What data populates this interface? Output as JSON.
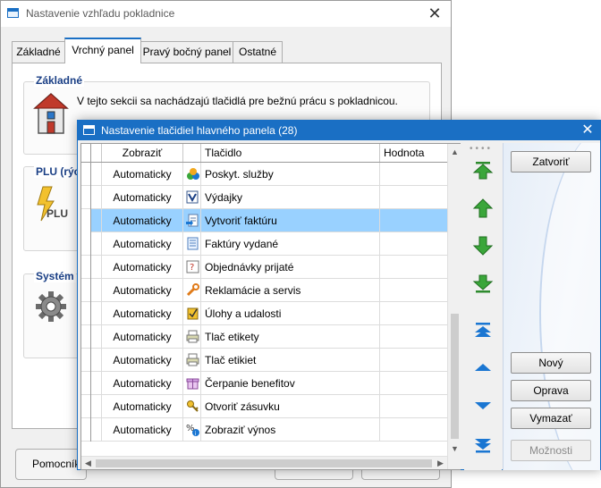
{
  "back_window": {
    "title": "Nastavenie vzhľadu pokladnice",
    "close_glyph": "✕",
    "tabs": [
      {
        "label": "Základné",
        "active": false
      },
      {
        "label": "Vrchný panel",
        "active": true
      },
      {
        "label": "Pravý bočný panel",
        "active": false
      },
      {
        "label": "Ostatné",
        "active": false
      }
    ],
    "groups": {
      "zakladne": {
        "title": "Základné",
        "text": "V tejto sekcii sa nachádzajú tlačidlá pre bežnú prácu s pokladnicou.",
        "icon": "house-icon"
      },
      "plu": {
        "title": "PLU (rých",
        "icon": "plu-lightning-icon"
      },
      "system": {
        "title": "Systém",
        "icon": "gear-icon"
      }
    },
    "footer": {
      "help_label": "Pomocník"
    }
  },
  "dialog": {
    "title": "Nastavenie tlačidiel hlavného panela (28)",
    "close_glyph": "✕",
    "columns": {
      "show": "Zobraziť",
      "button": "Tlačidlo",
      "value": "Hodnota"
    },
    "rows": [
      {
        "show": "Automaticky",
        "button": "Poskyt. služby",
        "value": "",
        "icon": "services-icon",
        "selected": false
      },
      {
        "show": "Automaticky",
        "button": "Výdajky",
        "value": "",
        "icon": "expense-icon",
        "selected": false
      },
      {
        "show": "Automaticky",
        "button": "Vytvoriť faktúru",
        "value": "",
        "icon": "create-invoice-icon",
        "selected": true
      },
      {
        "show": "Automaticky",
        "button": "Faktúry vydané",
        "value": "",
        "icon": "issued-invoices-icon",
        "selected": false
      },
      {
        "show": "Automaticky",
        "button": "Objednávky prijaté",
        "value": "",
        "icon": "received-orders-icon",
        "selected": false
      },
      {
        "show": "Automaticky",
        "button": "Reklamácie a servis",
        "value": "",
        "icon": "wrench-icon",
        "selected": false
      },
      {
        "show": "Automaticky",
        "button": "Úlohy a udalosti",
        "value": "",
        "icon": "tasks-icon",
        "selected": false
      },
      {
        "show": "Automaticky",
        "button": "Tlač etikety",
        "value": "",
        "icon": "print-label-icon",
        "selected": false
      },
      {
        "show": "Automaticky",
        "button": "Tlač etikiet",
        "value": "",
        "icon": "print-labels-icon",
        "selected": false
      },
      {
        "show": "Automaticky",
        "button": "Čerpanie benefitov",
        "value": "",
        "icon": "gift-icon",
        "selected": false
      },
      {
        "show": "Automaticky",
        "button": "Otvoriť zásuvku",
        "value": "",
        "icon": "drawer-key-icon",
        "selected": false
      },
      {
        "show": "Automaticky",
        "button": "Zobraziť výnos",
        "value": "",
        "icon": "percent-info-icon",
        "selected": false
      }
    ],
    "move_buttons": [
      "move-top-green-icon",
      "move-up-green-icon",
      "move-down-green-icon",
      "move-bottom-green-icon",
      "scroll-top-icon",
      "scroll-up-icon",
      "scroll-down-icon",
      "scroll-bottom-icon"
    ],
    "side_buttons": {
      "close": "Zatvoriť",
      "new": "Nový",
      "edit": "Oprava",
      "delete": "Vymazať",
      "options": "Možnosti"
    },
    "colors": {
      "accent": "#1a6fc4",
      "selection": "#99d1ff",
      "green_arrow": "#3aa63a",
      "blue_arrow": "#1a76d2"
    }
  }
}
